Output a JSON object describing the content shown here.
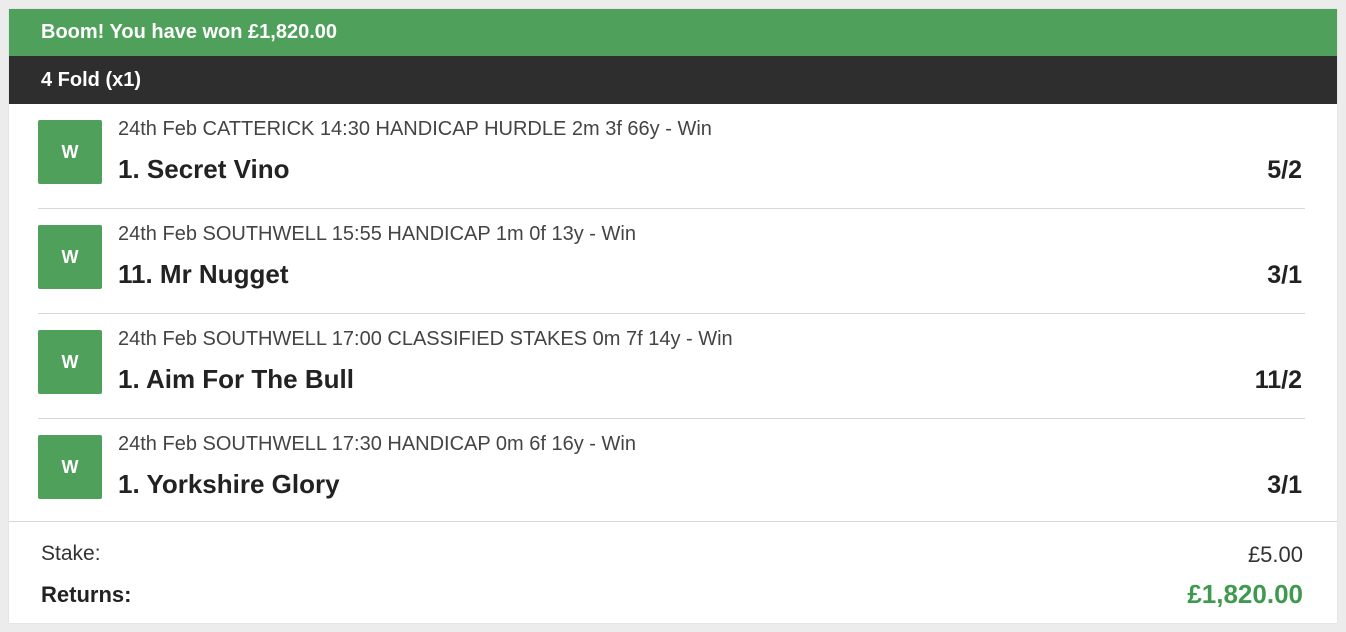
{
  "banner": {
    "text": "Boom! You have won £1,820.00"
  },
  "bet": {
    "type_label": "4 Fold (x1)"
  },
  "selections": [
    {
      "result": "W",
      "event": "24th Feb CATTERICK 14:30 HANDICAP HURDLE 2m 3f 66y - Win",
      "runner": "1. Secret Vino",
      "odds": "5/2"
    },
    {
      "result": "W",
      "event": "24th Feb SOUTHWELL 15:55 HANDICAP 1m 0f 13y - Win",
      "runner": "11. Mr Nugget",
      "odds": "3/1"
    },
    {
      "result": "W",
      "event": "24th Feb SOUTHWELL 17:00 CLASSIFIED STAKES 0m 7f 14y - Win",
      "runner": "1. Aim For The Bull",
      "odds": "11/2"
    },
    {
      "result": "W",
      "event": "24th Feb SOUTHWELL 17:30 HANDICAP 0m 6f 16y - Win",
      "runner": "1. Yorkshire Glory",
      "odds": "3/1"
    }
  ],
  "summary": {
    "stake_label": "Stake:",
    "stake_value": "£5.00",
    "returns_label": "Returns:",
    "returns_value": "£1,820.00"
  },
  "colors": {
    "win_green": "#4ea05a",
    "returns_green": "#3f9a4f",
    "header_dark": "#2e2e2e"
  }
}
